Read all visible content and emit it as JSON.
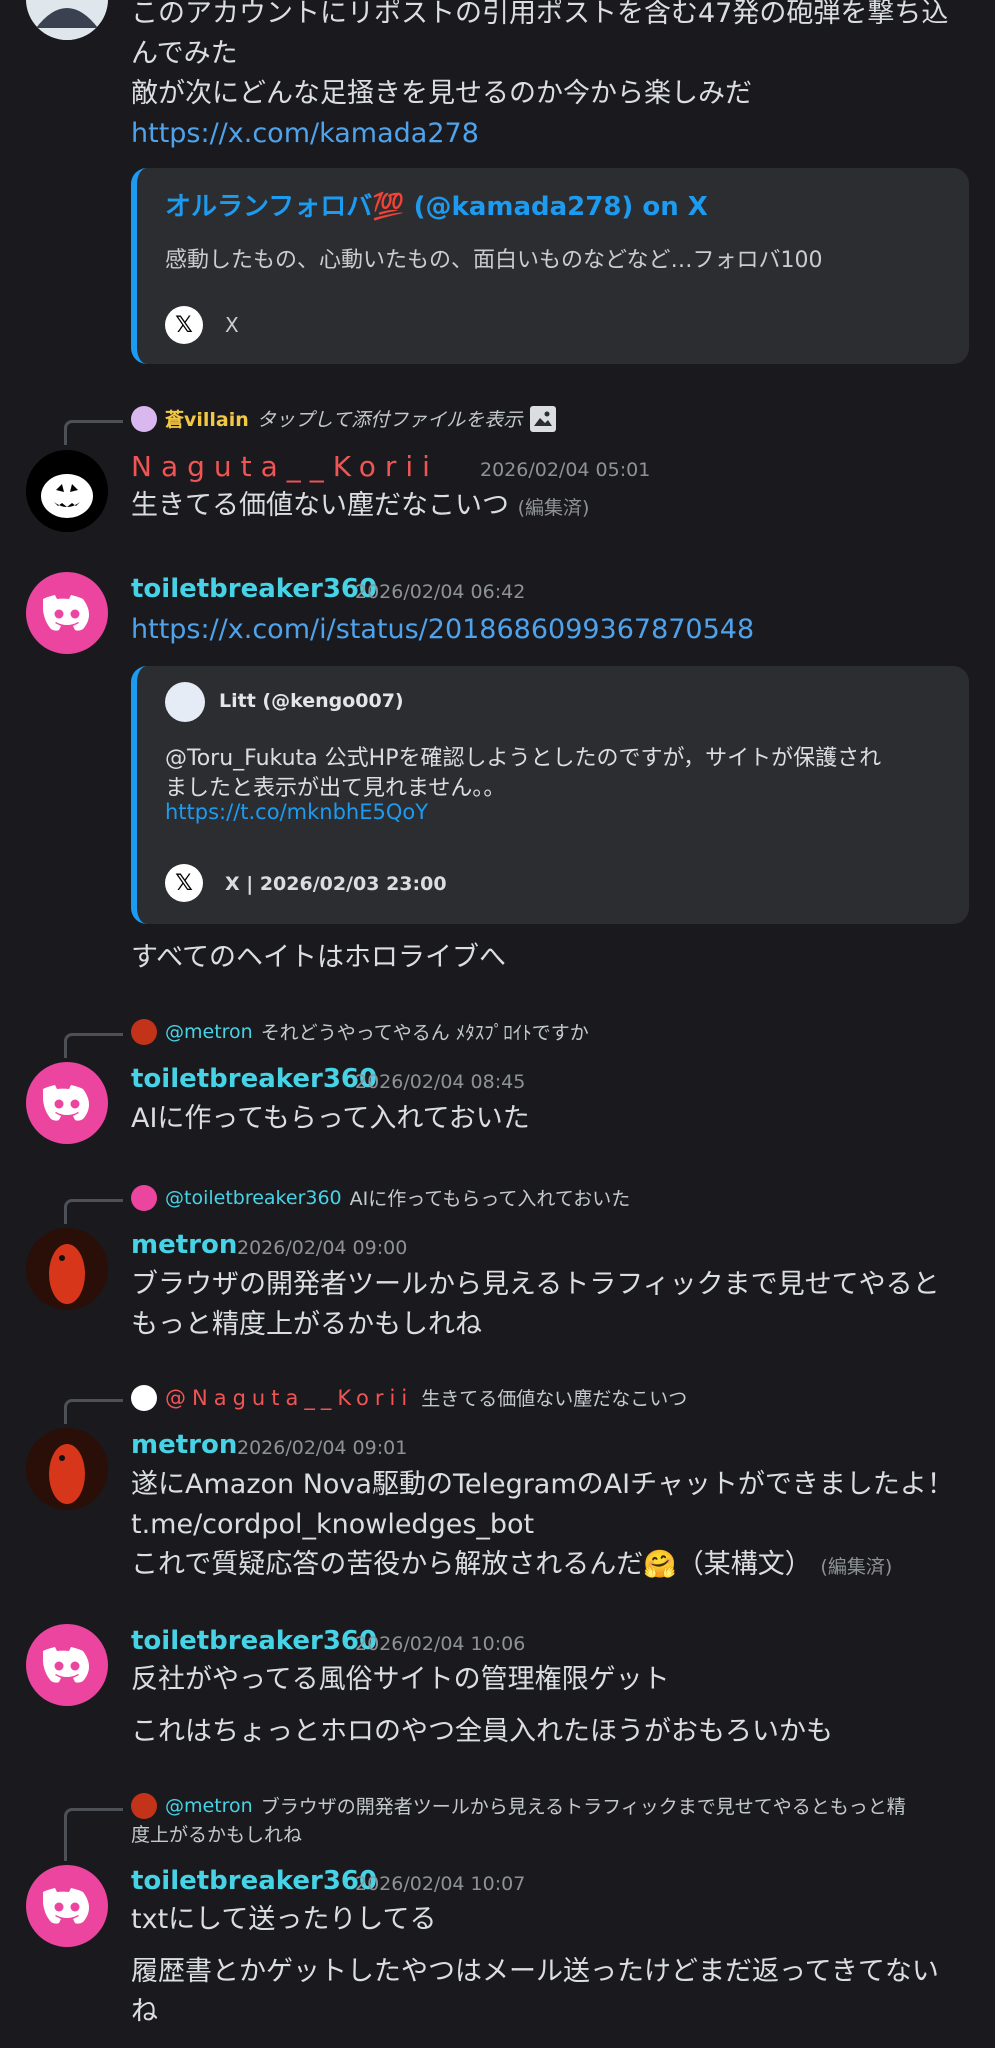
{
  "top_message": {
    "line1": "このアカウントにリポストの引用ポストを含む47発の砲弾を撃ち込",
    "line2": "んでみた",
    "line3": "敵が次にどんな足掻きを見せるのか今から楽しみだ",
    "link": "https://x.com/kamada278",
    "embed": {
      "title": "オルランフォロバ💯 (@kamada278) on X",
      "description": "感動したもの、心動いたもの、面白いものなどなど…フォロバ100",
      "footer": "X"
    }
  },
  "msg_naguta": {
    "reply": {
      "author": "蒼villain",
      "text": "タップして添付ファイルを表示"
    },
    "author": "Naguta__Korii",
    "timestamp": "2026/02/04 05:01",
    "text": "生きてる価値ない塵だなこいつ",
    "edited": "(編集済)"
  },
  "msg_toilet1": {
    "author": "toiletbreaker360",
    "timestamp": "2026/02/04 06:42",
    "link": "https://x.com/i/status/2018686099367870548",
    "embed": {
      "author": "Litt (@kengo007)",
      "line1": "@Toru_Fukuta 公式HPを確認しようとしたのですが，サイトが保護され",
      "line2": "ましたと表示が出て見れません。。",
      "link": "https://t.co/mknbhE5QoY",
      "footer": "X | 2026/02/03 23:00"
    },
    "followup": "すべてのヘイトはホロライブへ"
  },
  "msg_toilet2": {
    "reply": {
      "author": "@metron",
      "text": "それどうやってやるん ﾒﾀｽﾌﾟﾛｲﾄですか"
    },
    "author": "toiletbreaker360",
    "timestamp": "2026/02/04 08:45",
    "text": "AIに作ってもらって入れておいた"
  },
  "msg_metron1": {
    "reply": {
      "author": "@toiletbreaker360",
      "text": "AIに作ってもらって入れておいた"
    },
    "author": "metron",
    "timestamp": "2026/02/04 09:00",
    "line1": "ブラウザの開発者ツールから見えるトラフィックまで見せてやると",
    "line2": "もっと精度上がるかもしれね"
  },
  "msg_metron2": {
    "reply": {
      "author": "@Naguta__Korii",
      "text": "生きてる価値ない塵だなこいつ"
    },
    "author": "metron",
    "timestamp": "2026/02/04 09:01",
    "line1": "遂にAmazon Nova駆動のTelegramのAIチャットができましたよ！",
    "line2": "t.me/cordpol_knowledges_bot",
    "line3": "これで質疑応答の苦役から解放されるんだ🤗（某構文）",
    "edited": "(編集済)"
  },
  "msg_toilet3": {
    "author": "toiletbreaker360",
    "timestamp": "2026/02/04 10:06",
    "line1": "反社がやってる風俗サイトの管理権限ゲット",
    "line2": "これはちょっとホロのやつ全員入れたほうがおもろいかも"
  },
  "msg_toilet4": {
    "reply": {
      "author": "@metron",
      "text": "ブラウザの開発者ツールから見えるトラフィックまで見せてやるともっと精",
      "text2": "度上がるかもしれね"
    },
    "author": "toiletbreaker360",
    "timestamp": "2026/02/04 10:07",
    "line1": "txtにして送ったりしてる",
    "line2": "履歴書とかゲットしたやつはメール送ったけどまだ返ってきてない",
    "line3": "ね"
  }
}
